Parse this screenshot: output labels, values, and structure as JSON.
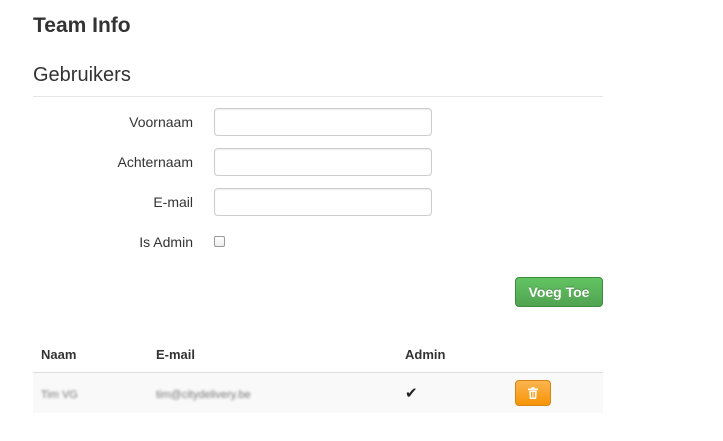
{
  "page": {
    "title": "Team Info"
  },
  "users_section": {
    "title": "Gebruikers"
  },
  "form": {
    "first_name_label": "Voornaam",
    "first_name_value": "",
    "last_name_label": "Achternaam",
    "last_name_value": "",
    "email_label": "E-mail",
    "email_value": "",
    "is_admin_label": "Is Admin",
    "is_admin_checked": false,
    "add_button_label": "Voeg Toe"
  },
  "table": {
    "headers": [
      "Naam",
      "E-mail",
      "Admin",
      ""
    ],
    "rows": [
      {
        "name": "Tim VG",
        "email": "tim@citydelivery.be",
        "admin": true,
        "admin_symbol": "✔"
      }
    ]
  },
  "icons": {
    "admin_check": "check-icon",
    "delete": "trash-icon"
  },
  "colors": {
    "add_button": "#5bb75b",
    "delete_button": "#faa732",
    "row_background": "#f9f9f9"
  }
}
